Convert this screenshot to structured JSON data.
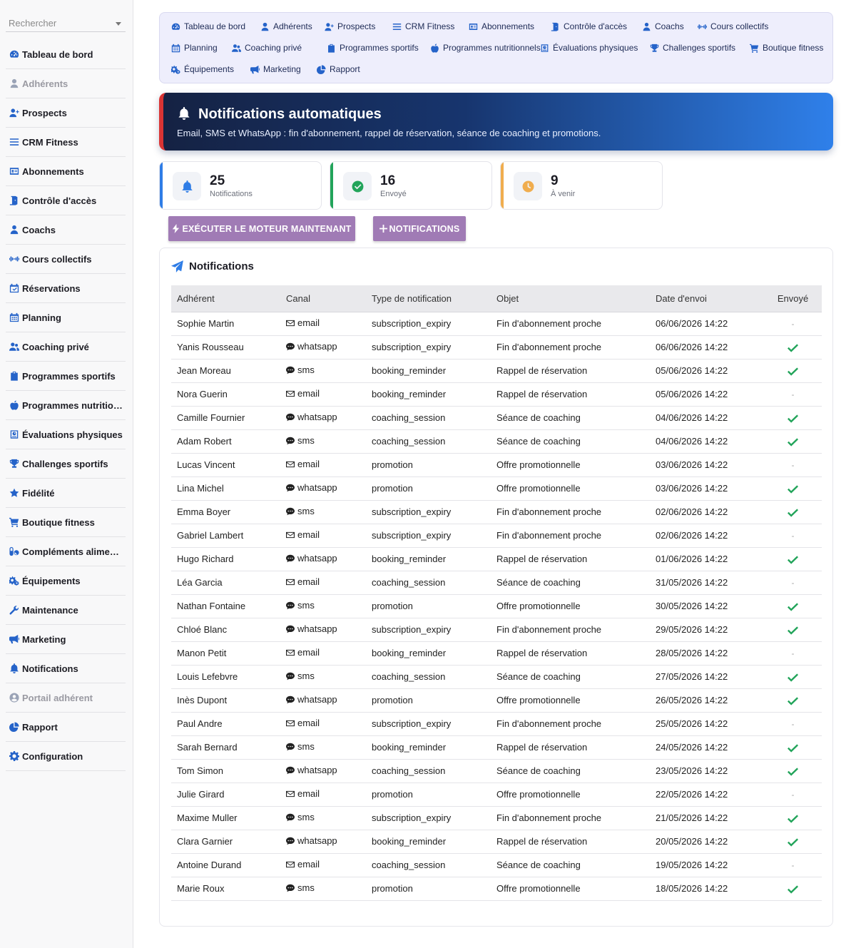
{
  "sidebar": {
    "search_placeholder": "Rechercher",
    "items": [
      {
        "label": "Tableau de bord",
        "icon": "dashboard-icon",
        "muted": false
      },
      {
        "label": "Adhérents",
        "icon": "user-icon",
        "muted": true
      },
      {
        "label": "Prospects",
        "icon": "user-plus-icon",
        "muted": false
      },
      {
        "label": "CRM Fitness",
        "icon": "list-icon",
        "muted": false
      },
      {
        "label": "Abonnements",
        "icon": "id-card-icon",
        "muted": false
      },
      {
        "label": "Contrôle d'accès",
        "icon": "door-icon",
        "muted": false
      },
      {
        "label": "Coachs",
        "icon": "coach-icon",
        "muted": false
      },
      {
        "label": "Cours collectifs",
        "icon": "dumbbell-icon",
        "muted": false
      },
      {
        "label": "Réservations",
        "icon": "calendar-check-icon",
        "muted": false
      },
      {
        "label": "Planning",
        "icon": "calendar-icon",
        "muted": false
      },
      {
        "label": "Coaching privé",
        "icon": "users-icon",
        "muted": false
      },
      {
        "label": "Programmes sportifs",
        "icon": "clipboard-icon",
        "muted": false
      },
      {
        "label": "Programmes nutritio…",
        "icon": "apple-icon",
        "muted": false
      },
      {
        "label": "Évaluations physiques",
        "icon": "assessment-icon",
        "muted": false
      },
      {
        "label": "Challenges sportifs",
        "icon": "trophy-icon",
        "muted": false
      },
      {
        "label": "Fidélité",
        "icon": "star-icon",
        "muted": false
      },
      {
        "label": "Boutique fitness",
        "icon": "cart-icon",
        "muted": false
      },
      {
        "label": "Compléments alime…",
        "icon": "pills-icon",
        "muted": false
      },
      {
        "label": "Équipements",
        "icon": "gears-icon",
        "muted": false
      },
      {
        "label": "Maintenance",
        "icon": "wrench-icon",
        "muted": false
      },
      {
        "label": "Marketing",
        "icon": "megaphone-icon",
        "muted": false
      },
      {
        "label": "Notifications",
        "icon": "bell-icon",
        "muted": false
      },
      {
        "label": "Portail adhérent",
        "icon": "user-circle-icon",
        "muted": true
      },
      {
        "label": "Rapport",
        "icon": "pie-chart-icon",
        "muted": false
      },
      {
        "label": "Configuration",
        "icon": "gear-icon",
        "muted": false
      }
    ]
  },
  "topnav": {
    "rows": [
      [
        {
          "label": "Tableau de bord",
          "icon": "dashboard-icon"
        },
        {
          "label": "Adhérents",
          "icon": "user-icon"
        },
        {
          "label": "Prospects",
          "icon": "user-plus-icon"
        },
        {
          "label": "CRM Fitness",
          "icon": "list-icon"
        },
        {
          "label": "Abonnements",
          "icon": "id-card-icon"
        },
        {
          "label": "Contrôle d'accès",
          "icon": "door-icon"
        },
        {
          "label": "Coachs",
          "icon": "coach-icon"
        },
        {
          "label": "Cours collectifs",
          "icon": "dumbbell-icon"
        }
      ],
      [
        {
          "label": "Planning",
          "icon": "calendar-icon"
        },
        {
          "label": "Coaching privé",
          "icon": "users-icon"
        },
        {
          "label": "Programmes sportifs",
          "icon": "clipboard-icon"
        },
        {
          "label": "Programmes nutritionnels",
          "icon": "apple-icon"
        },
        {
          "label": "Évaluations physiques",
          "icon": "assessment-icon"
        },
        {
          "label": "Challenges sportifs",
          "icon": "trophy-icon"
        },
        {
          "label": "Boutique fitness",
          "icon": "cart-icon"
        }
      ],
      [
        {
          "label": "Équipements",
          "icon": "gears-icon"
        },
        {
          "label": "Marketing",
          "icon": "megaphone-icon"
        },
        {
          "label": "Rapport",
          "icon": "pie-chart-icon"
        }
      ]
    ]
  },
  "banner": {
    "title": "Notifications automatiques",
    "subtitle": "Email, SMS et WhatsApp : fin d'abonnement, rappel de réservation, séance de coaching et promotions."
  },
  "stats": [
    {
      "value": "25",
      "label": "Notifications",
      "accent": "#2f7de6",
      "icon": "bell-icon"
    },
    {
      "value": "16",
      "label": "Envoyé",
      "accent": "#22a45a",
      "icon": "check-circle-icon"
    },
    {
      "value": "9",
      "label": "À venir",
      "accent": "#f0ad4e",
      "icon": "clock-icon"
    }
  ],
  "actions": {
    "run_engine": "EXÉCUTER LE MOTEUR MAINTENANT",
    "add_notification": "NOTIFICATIONS"
  },
  "table": {
    "title": "Notifications",
    "columns": [
      "Adhérent",
      "Canal",
      "Type de notification",
      "Objet",
      "Date d'envoi",
      "Envoyé"
    ],
    "rows": [
      {
        "member": "Sophie Martin",
        "channel": "email",
        "type": "subscription_expiry",
        "subject": "Fin d'abonnement proche",
        "date": "06/06/2026 14:22",
        "sent": false
      },
      {
        "member": "Yanis Rousseau",
        "channel": "whatsapp",
        "type": "subscription_expiry",
        "subject": "Fin d'abonnement proche",
        "date": "06/06/2026 14:22",
        "sent": true
      },
      {
        "member": "Jean Moreau",
        "channel": "sms",
        "type": "booking_reminder",
        "subject": "Rappel de réservation",
        "date": "05/06/2026 14:22",
        "sent": true
      },
      {
        "member": "Nora Guerin",
        "channel": "email",
        "type": "booking_reminder",
        "subject": "Rappel de réservation",
        "date": "05/06/2026 14:22",
        "sent": false
      },
      {
        "member": "Camille Fournier",
        "channel": "whatsapp",
        "type": "coaching_session",
        "subject": "Séance de coaching",
        "date": "04/06/2026 14:22",
        "sent": true
      },
      {
        "member": "Adam Robert",
        "channel": "sms",
        "type": "coaching_session",
        "subject": "Séance de coaching",
        "date": "04/06/2026 14:22",
        "sent": true
      },
      {
        "member": "Lucas Vincent",
        "channel": "email",
        "type": "promotion",
        "subject": "Offre promotionnelle",
        "date": "03/06/2026 14:22",
        "sent": false
      },
      {
        "member": "Lina Michel",
        "channel": "whatsapp",
        "type": "promotion",
        "subject": "Offre promotionnelle",
        "date": "03/06/2026 14:22",
        "sent": true
      },
      {
        "member": "Emma Boyer",
        "channel": "sms",
        "type": "subscription_expiry",
        "subject": "Fin d'abonnement proche",
        "date": "02/06/2026 14:22",
        "sent": true
      },
      {
        "member": "Gabriel Lambert",
        "channel": "email",
        "type": "subscription_expiry",
        "subject": "Fin d'abonnement proche",
        "date": "02/06/2026 14:22",
        "sent": false
      },
      {
        "member": "Hugo Richard",
        "channel": "whatsapp",
        "type": "booking_reminder",
        "subject": "Rappel de réservation",
        "date": "01/06/2026 14:22",
        "sent": true
      },
      {
        "member": "Léa Garcia",
        "channel": "email",
        "type": "coaching_session",
        "subject": "Séance de coaching",
        "date": "31/05/2026 14:22",
        "sent": false
      },
      {
        "member": "Nathan Fontaine",
        "channel": "sms",
        "type": "promotion",
        "subject": "Offre promotionnelle",
        "date": "30/05/2026 14:22",
        "sent": true
      },
      {
        "member": "Chloé Blanc",
        "channel": "whatsapp",
        "type": "subscription_expiry",
        "subject": "Fin d'abonnement proche",
        "date": "29/05/2026 14:22",
        "sent": true
      },
      {
        "member": "Manon Petit",
        "channel": "email",
        "type": "booking_reminder",
        "subject": "Rappel de réservation",
        "date": "28/05/2026 14:22",
        "sent": false
      },
      {
        "member": "Louis Lefebvre",
        "channel": "sms",
        "type": "coaching_session",
        "subject": "Séance de coaching",
        "date": "27/05/2026 14:22",
        "sent": true
      },
      {
        "member": "Inès Dupont",
        "channel": "whatsapp",
        "type": "promotion",
        "subject": "Offre promotionnelle",
        "date": "26/05/2026 14:22",
        "sent": true
      },
      {
        "member": "Paul Andre",
        "channel": "email",
        "type": "subscription_expiry",
        "subject": "Fin d'abonnement proche",
        "date": "25/05/2026 14:22",
        "sent": false
      },
      {
        "member": "Sarah Bernard",
        "channel": "sms",
        "type": "booking_reminder",
        "subject": "Rappel de réservation",
        "date": "24/05/2026 14:22",
        "sent": true
      },
      {
        "member": "Tom Simon",
        "channel": "whatsapp",
        "type": "coaching_session",
        "subject": "Séance de coaching",
        "date": "23/05/2026 14:22",
        "sent": true
      },
      {
        "member": "Julie Girard",
        "channel": "email",
        "type": "promotion",
        "subject": "Offre promotionnelle",
        "date": "22/05/2026 14:22",
        "sent": false
      },
      {
        "member": "Maxime Muller",
        "channel": "sms",
        "type": "subscription_expiry",
        "subject": "Fin d'abonnement proche",
        "date": "21/05/2026 14:22",
        "sent": true
      },
      {
        "member": "Clara Garnier",
        "channel": "whatsapp",
        "type": "booking_reminder",
        "subject": "Rappel de réservation",
        "date": "20/05/2026 14:22",
        "sent": true
      },
      {
        "member": "Antoine Durand",
        "channel": "email",
        "type": "coaching_session",
        "subject": "Séance de coaching",
        "date": "19/05/2026 14:22",
        "sent": false
      },
      {
        "member": "Marie Roux",
        "channel": "sms",
        "type": "promotion",
        "subject": "Offre promotionnelle",
        "date": "18/05/2026 14:22",
        "sent": true
      }
    ],
    "unsent_marker": "-"
  },
  "colors": {
    "primary": "#2563c9",
    "button": "#a07bb5",
    "success": "#22a45a",
    "warning": "#f0ad4e",
    "banner_accent": "#d93434"
  }
}
